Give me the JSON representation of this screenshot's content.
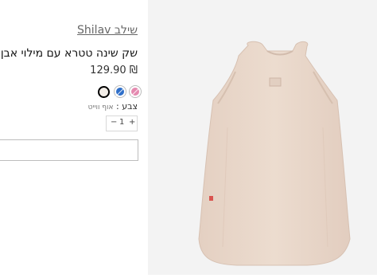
{
  "product": {
    "brand": "שילב Shilav",
    "title": "שק שינה טטרא עם מילוי אבן",
    "price": "129.90 ₪",
    "color_label": "צבע :",
    "color_value": "אוף ווייט",
    "swatches": [
      {
        "name": "off-white",
        "color": "#f3eee8",
        "selected": true
      },
      {
        "name": "blue",
        "color": "#2f6fc9",
        "selected": false
      },
      {
        "name": "pink",
        "color": "#e58ab0",
        "selected": false
      }
    ],
    "quantity": {
      "minus": "−",
      "value": "1",
      "plus": "+"
    }
  },
  "image": {
    "alt": "sleeping bag",
    "fabric_color": "#e9d7ca",
    "background": "#f3f3f3"
  }
}
